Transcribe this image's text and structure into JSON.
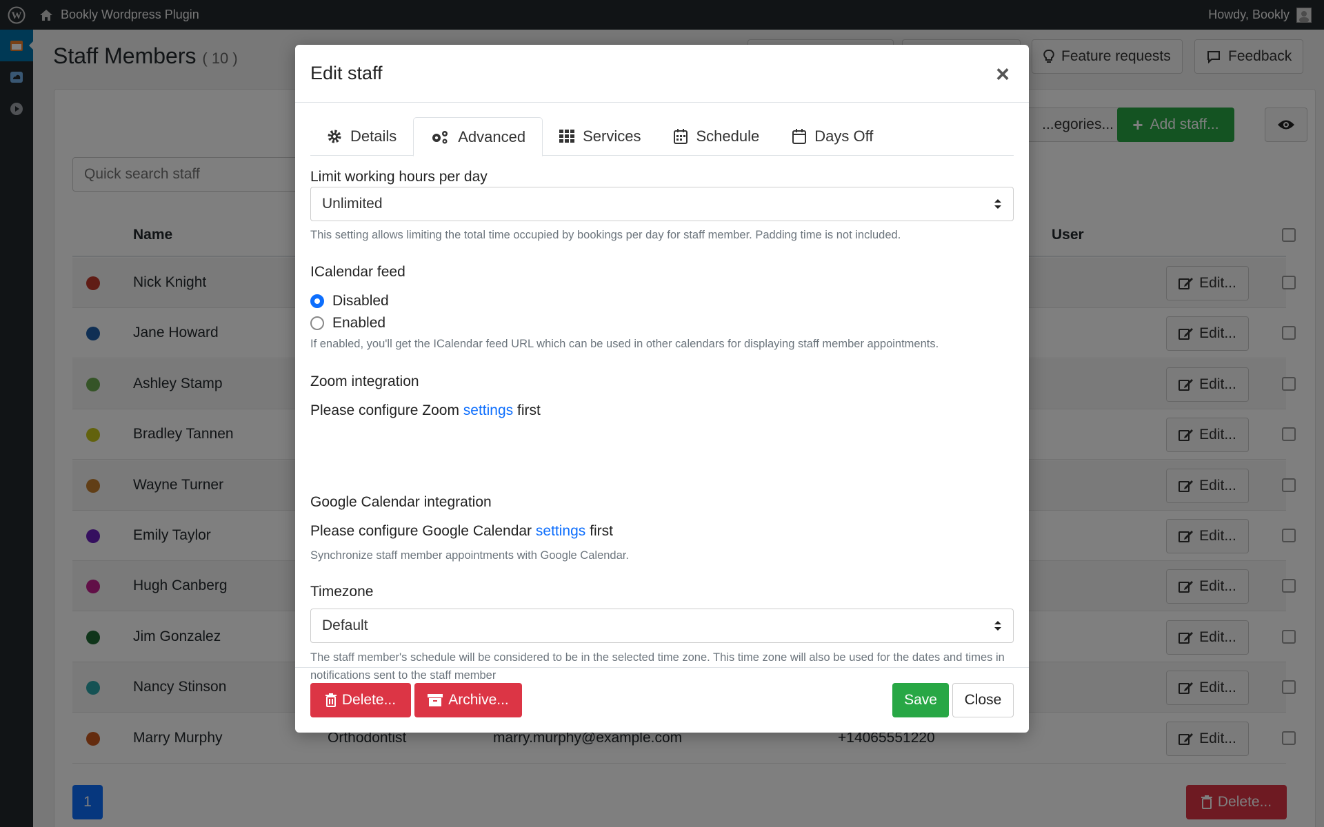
{
  "adminbar": {
    "site_name": "Bookly Wordpress Plugin",
    "howdy": "Howdy, Bookly"
  },
  "page": {
    "title": "Staff Members",
    "count": "( 10 )",
    "feature_requests": "Feature requests",
    "feedback": "Feedback",
    "categories_btn": "...egories...",
    "add_staff": "Add staff...",
    "search_placeholder": "Quick search staff",
    "col_name": "Name",
    "col_user": "User",
    "edit_label": "Edit...",
    "page_number": "1",
    "delete_bottom": "Delete..."
  },
  "staff": [
    {
      "name": "Nick Knight",
      "color": "#c0392b"
    },
    {
      "name": "Jane Howard",
      "color": "#1f5fa8"
    },
    {
      "name": "Ashley Stamp",
      "color": "#6aa84f"
    },
    {
      "name": "Bradley Tannen",
      "color": "#c5c51b"
    },
    {
      "name": "Wayne Turner",
      "color": "#c27c2c"
    },
    {
      "name": "Emily Taylor",
      "color": "#6a1fbf"
    },
    {
      "name": "Hugh Canberg",
      "color": "#c21f8f"
    },
    {
      "name": "Jim Gonzalez",
      "color": "#1f6b34"
    },
    {
      "name": "Nancy Stinson",
      "color": "#2aa5a8"
    },
    {
      "name": "Marry Murphy",
      "color": "#c8581f",
      "position": "Orthodontist",
      "email": "marry.murphy@example.com",
      "phone": "+14065551220"
    }
  ],
  "modal": {
    "title": "Edit staff",
    "tabs": [
      "Details",
      "Advanced",
      "Services",
      "Schedule",
      "Days Off"
    ],
    "limit_label": "Limit working hours per day",
    "limit_value": "Unlimited",
    "limit_help": "This setting allows limiting the total time occupied by bookings per day for staff member. Padding time is not included.",
    "ical_label": "ICalendar feed",
    "ical_disabled": "Disabled",
    "ical_enabled": "Enabled",
    "ical_help": "If enabled, you'll get the ICalendar feed URL which can be used in other calendars for displaying staff member appointments.",
    "zoom_label": "Zoom integration",
    "zoom_pre": "Please configure Zoom",
    "zoom_link": "settings",
    "zoom_post": "first",
    "gcal_label": "Google Calendar integration",
    "gcal_pre": "Please configure Google Calendar",
    "gcal_link": "settings",
    "gcal_post": "first",
    "gcal_help": "Synchronize staff member appointments with Google Calendar.",
    "tz_label": "Timezone",
    "tz_value": "Default",
    "tz_help": "The staff member's schedule will be considered to be in the selected time zone. This time zone will also be used for the dates and times in notifications sent to the staff member",
    "delete_btn": "Delete...",
    "archive_btn": "Archive...",
    "save_btn": "Save",
    "close_btn": "Close"
  }
}
